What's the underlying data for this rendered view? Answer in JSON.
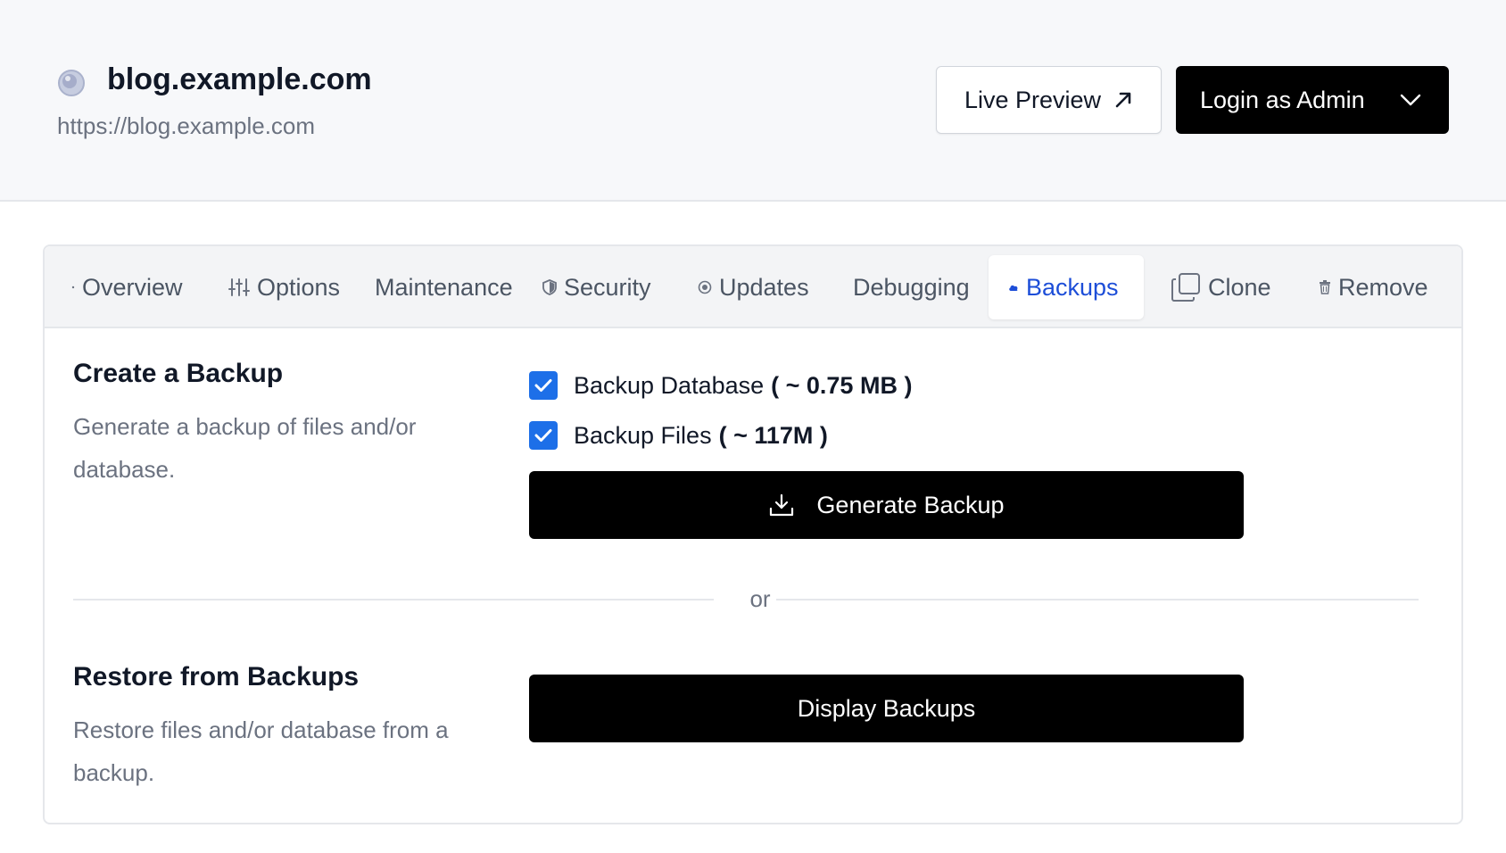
{
  "site": {
    "name": "blog.example.com",
    "url": "https://blog.example.com"
  },
  "header_actions": {
    "live_preview": "Live Preview",
    "login_admin": "Login as Admin"
  },
  "tabs": [
    {
      "label": "Overview",
      "icon": "dot-icon"
    },
    {
      "label": "Options",
      "icon": "sliders-icon"
    },
    {
      "label": "Maintenance",
      "icon": ""
    },
    {
      "label": "Security",
      "icon": "shield-icon"
    },
    {
      "label": "Updates",
      "icon": "update-circle-icon"
    },
    {
      "label": "Debugging",
      "icon": ""
    },
    {
      "label": "Backups",
      "icon": "cloud-icon",
      "active": true
    },
    {
      "label": "Clone",
      "icon": "copy-icon"
    },
    {
      "label": "Remove",
      "icon": "trash-icon"
    }
  ],
  "create_backup": {
    "title": "Create a Backup",
    "description": "Generate a backup of files and/or database.",
    "options": [
      {
        "label": "Backup Database",
        "size": "( ~ 0.75 MB )",
        "checked": true
      },
      {
        "label": "Backup Files",
        "size": "( ~ 117M )",
        "checked": true
      }
    ],
    "button": "Generate Backup"
  },
  "separator": "or",
  "restore": {
    "title": "Restore from Backups",
    "description": "Restore files and/or database from a backup.",
    "button": "Display Backups"
  },
  "colors": {
    "accent": "#1d4ed8",
    "checkbox": "#1d6fe8",
    "primary_button": "#000000"
  }
}
